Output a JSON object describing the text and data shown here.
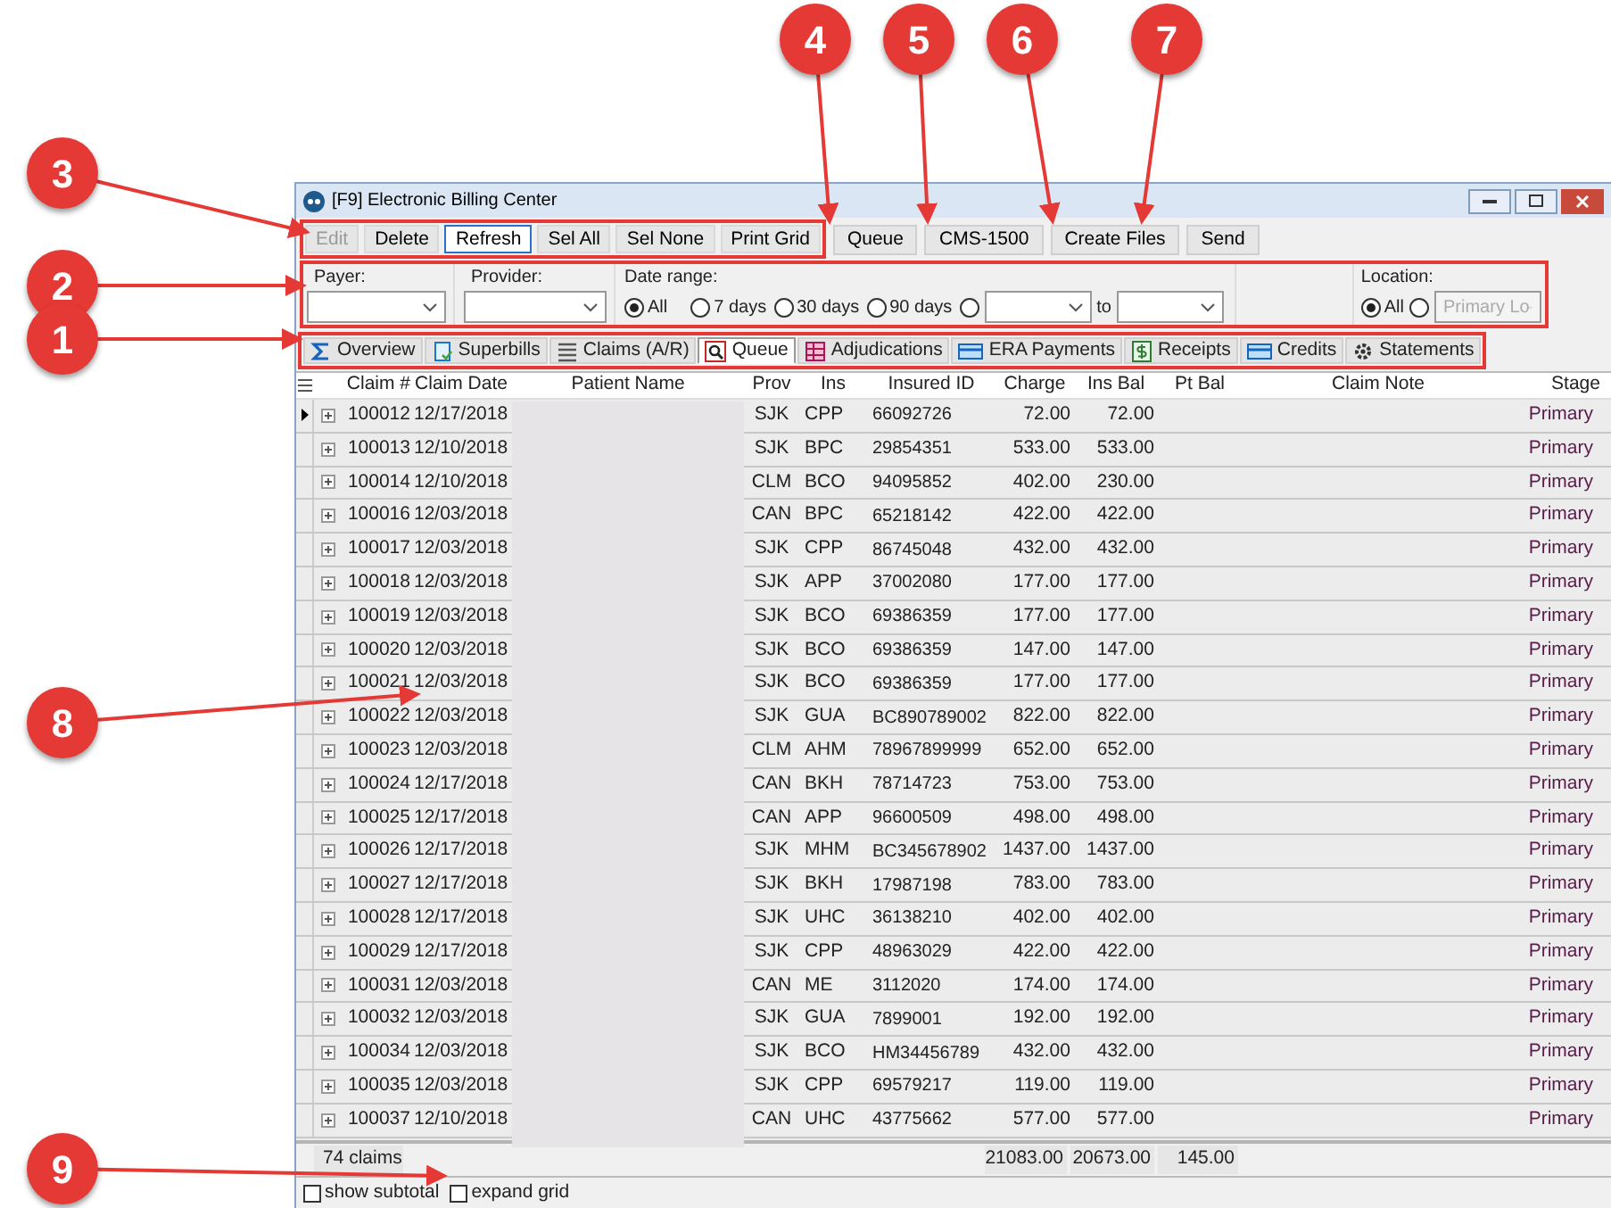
{
  "callouts": [
    {
      "number": "3"
    },
    {
      "number": "2"
    },
    {
      "number": "1"
    },
    {
      "number": "8"
    },
    {
      "number": "9"
    },
    {
      "number": "4"
    },
    {
      "number": "5"
    },
    {
      "number": "6"
    },
    {
      "number": "7"
    }
  ],
  "window": {
    "title": "[F9] Electronic Billing Center"
  },
  "toolbar": {
    "group": [
      {
        "label": "Edit",
        "disabled": true,
        "focused": false
      },
      {
        "label": "Delete",
        "disabled": false,
        "focused": false
      },
      {
        "label": "Refresh",
        "disabled": false,
        "focused": true
      },
      {
        "label": "Sel All",
        "disabled": false,
        "focused": false
      },
      {
        "label": "Sel None",
        "disabled": false,
        "focused": false
      },
      {
        "label": "Print Grid",
        "disabled": false,
        "focused": false
      }
    ],
    "actions": [
      {
        "label": "Queue"
      },
      {
        "label": "CMS-1500"
      },
      {
        "label": "Create Files"
      },
      {
        "label": "Send"
      }
    ]
  },
  "filters": {
    "payer": {
      "label": "Payer:"
    },
    "provider": {
      "label": "Provider:"
    },
    "date_range": {
      "label": "Date range:",
      "options": [
        {
          "label": "All",
          "selected": true
        },
        {
          "label": "7 days",
          "selected": false
        },
        {
          "label": "30 days",
          "selected": false
        },
        {
          "label": "90 days",
          "selected": false
        }
      ],
      "custom_selected": false,
      "to_label": "to"
    },
    "location": {
      "label": "Location:",
      "options": [
        {
          "label": "All",
          "selected": true
        }
      ],
      "other_selected": false,
      "other_value": "Primary Lo"
    }
  },
  "tabs": [
    {
      "label": "Overview",
      "selected": false
    },
    {
      "label": "Superbills",
      "selected": false
    },
    {
      "label": "Claims (A/R)",
      "selected": false
    },
    {
      "label": "Queue",
      "selected": true
    },
    {
      "label": "Adjudications",
      "selected": false
    },
    {
      "label": "ERA Payments",
      "selected": false
    },
    {
      "label": "Receipts",
      "selected": false
    },
    {
      "label": "Credits",
      "selected": false
    },
    {
      "label": "Statements",
      "selected": false
    }
  ],
  "table": {
    "columns": [
      "Claim #",
      "Claim Date",
      "Patient Name",
      "Prov",
      "Ins",
      "Insured ID",
      "Charge",
      "Ins Bal",
      "Pt Bal",
      "Claim Note",
      "Stage"
    ],
    "rows": [
      {
        "claim": "100012",
        "date": "12/17/2018",
        "prov": "SJK",
        "ins": "CPP",
        "insured_id": "66092726",
        "charge": "72.00",
        "ins_bal": "72.00",
        "stage": "Primary",
        "current": true
      },
      {
        "claim": "100013",
        "date": "12/10/2018",
        "prov": "SJK",
        "ins": "BPC",
        "insured_id": "29854351",
        "charge": "533.00",
        "ins_bal": "533.00",
        "stage": "Primary",
        "current": false
      },
      {
        "claim": "100014",
        "date": "12/10/2018",
        "prov": "CLM",
        "ins": "BCO",
        "insured_id": "94095852",
        "charge": "402.00",
        "ins_bal": "230.00",
        "stage": "Primary",
        "current": false
      },
      {
        "claim": "100016",
        "date": "12/03/2018",
        "prov": "CAN",
        "ins": "BPC",
        "insured_id": "65218142",
        "charge": "422.00",
        "ins_bal": "422.00",
        "stage": "Primary",
        "current": false
      },
      {
        "claim": "100017",
        "date": "12/03/2018",
        "prov": "SJK",
        "ins": "CPP",
        "insured_id": "86745048",
        "charge": "432.00",
        "ins_bal": "432.00",
        "stage": "Primary",
        "current": false
      },
      {
        "claim": "100018",
        "date": "12/03/2018",
        "prov": "SJK",
        "ins": "APP",
        "insured_id": "37002080",
        "charge": "177.00",
        "ins_bal": "177.00",
        "stage": "Primary",
        "current": false
      },
      {
        "claim": "100019",
        "date": "12/03/2018",
        "prov": "SJK",
        "ins": "BCO",
        "insured_id": "69386359",
        "charge": "177.00",
        "ins_bal": "177.00",
        "stage": "Primary",
        "current": false
      },
      {
        "claim": "100020",
        "date": "12/03/2018",
        "prov": "SJK",
        "ins": "BCO",
        "insured_id": "69386359",
        "charge": "147.00",
        "ins_bal": "147.00",
        "stage": "Primary",
        "current": false
      },
      {
        "claim": "100021",
        "date": "12/03/2018",
        "prov": "SJK",
        "ins": "BCO",
        "insured_id": "69386359",
        "charge": "177.00",
        "ins_bal": "177.00",
        "stage": "Primary",
        "current": false
      },
      {
        "claim": "100022",
        "date": "12/03/2018",
        "prov": "SJK",
        "ins": "GUA",
        "insured_id": "BC890789002",
        "charge": "822.00",
        "ins_bal": "822.00",
        "stage": "Primary",
        "current": false
      },
      {
        "claim": "100023",
        "date": "12/03/2018",
        "prov": "CLM",
        "ins": "AHM",
        "insured_id": "78967899999",
        "charge": "652.00",
        "ins_bal": "652.00",
        "stage": "Primary",
        "current": false
      },
      {
        "claim": "100024",
        "date": "12/17/2018",
        "prov": "CAN",
        "ins": "BKH",
        "insured_id": "78714723",
        "charge": "753.00",
        "ins_bal": "753.00",
        "stage": "Primary",
        "current": false
      },
      {
        "claim": "100025",
        "date": "12/17/2018",
        "prov": "CAN",
        "ins": "APP",
        "insured_id": "96600509",
        "charge": "498.00",
        "ins_bal": "498.00",
        "stage": "Primary",
        "current": false
      },
      {
        "claim": "100026",
        "date": "12/17/2018",
        "prov": "SJK",
        "ins": "MHM",
        "insured_id": "BC345678902",
        "charge": "1437.00",
        "ins_bal": "1437.00",
        "stage": "Primary",
        "current": false
      },
      {
        "claim": "100027",
        "date": "12/17/2018",
        "prov": "SJK",
        "ins": "BKH",
        "insured_id": "17987198",
        "charge": "783.00",
        "ins_bal": "783.00",
        "stage": "Primary",
        "current": false
      },
      {
        "claim": "100028",
        "date": "12/17/2018",
        "prov": "SJK",
        "ins": "UHC",
        "insured_id": "36138210",
        "charge": "402.00",
        "ins_bal": "402.00",
        "stage": "Primary",
        "current": false
      },
      {
        "claim": "100029",
        "date": "12/17/2018",
        "prov": "SJK",
        "ins": "CPP",
        "insured_id": "48963029",
        "charge": "422.00",
        "ins_bal": "422.00",
        "stage": "Primary",
        "current": false
      },
      {
        "claim": "100031",
        "date": "12/03/2018",
        "prov": "CAN",
        "ins": "ME",
        "insured_id": "3112020",
        "charge": "174.00",
        "ins_bal": "174.00",
        "stage": "Primary",
        "current": false
      },
      {
        "claim": "100032",
        "date": "12/03/2018",
        "prov": "SJK",
        "ins": "GUA",
        "insured_id": "7899001",
        "charge": "192.00",
        "ins_bal": "192.00",
        "stage": "Primary",
        "current": false
      },
      {
        "claim": "100034",
        "date": "12/03/2018",
        "prov": "SJK",
        "ins": "BCO",
        "insured_id": "HM34456789",
        "charge": "432.00",
        "ins_bal": "432.00",
        "stage": "Primary",
        "current": false
      },
      {
        "claim": "100035",
        "date": "12/03/2018",
        "prov": "SJK",
        "ins": "CPP",
        "insured_id": "69579217",
        "charge": "119.00",
        "ins_bal": "119.00",
        "stage": "Primary",
        "current": false
      },
      {
        "claim": "100037",
        "date": "12/10/2018",
        "prov": "CAN",
        "ins": "UHC",
        "insured_id": "43775662",
        "charge": "577.00",
        "ins_bal": "577.00",
        "stage": "Primary",
        "current": false
      }
    ],
    "totals": {
      "count": "74 claims",
      "charge": "21083.00",
      "ins_bal": "20673.00",
      "pt_bal": "145.00"
    }
  },
  "options": [
    {
      "label": "show subtotal",
      "checked": false
    },
    {
      "label": "expand grid",
      "checked": false
    }
  ]
}
